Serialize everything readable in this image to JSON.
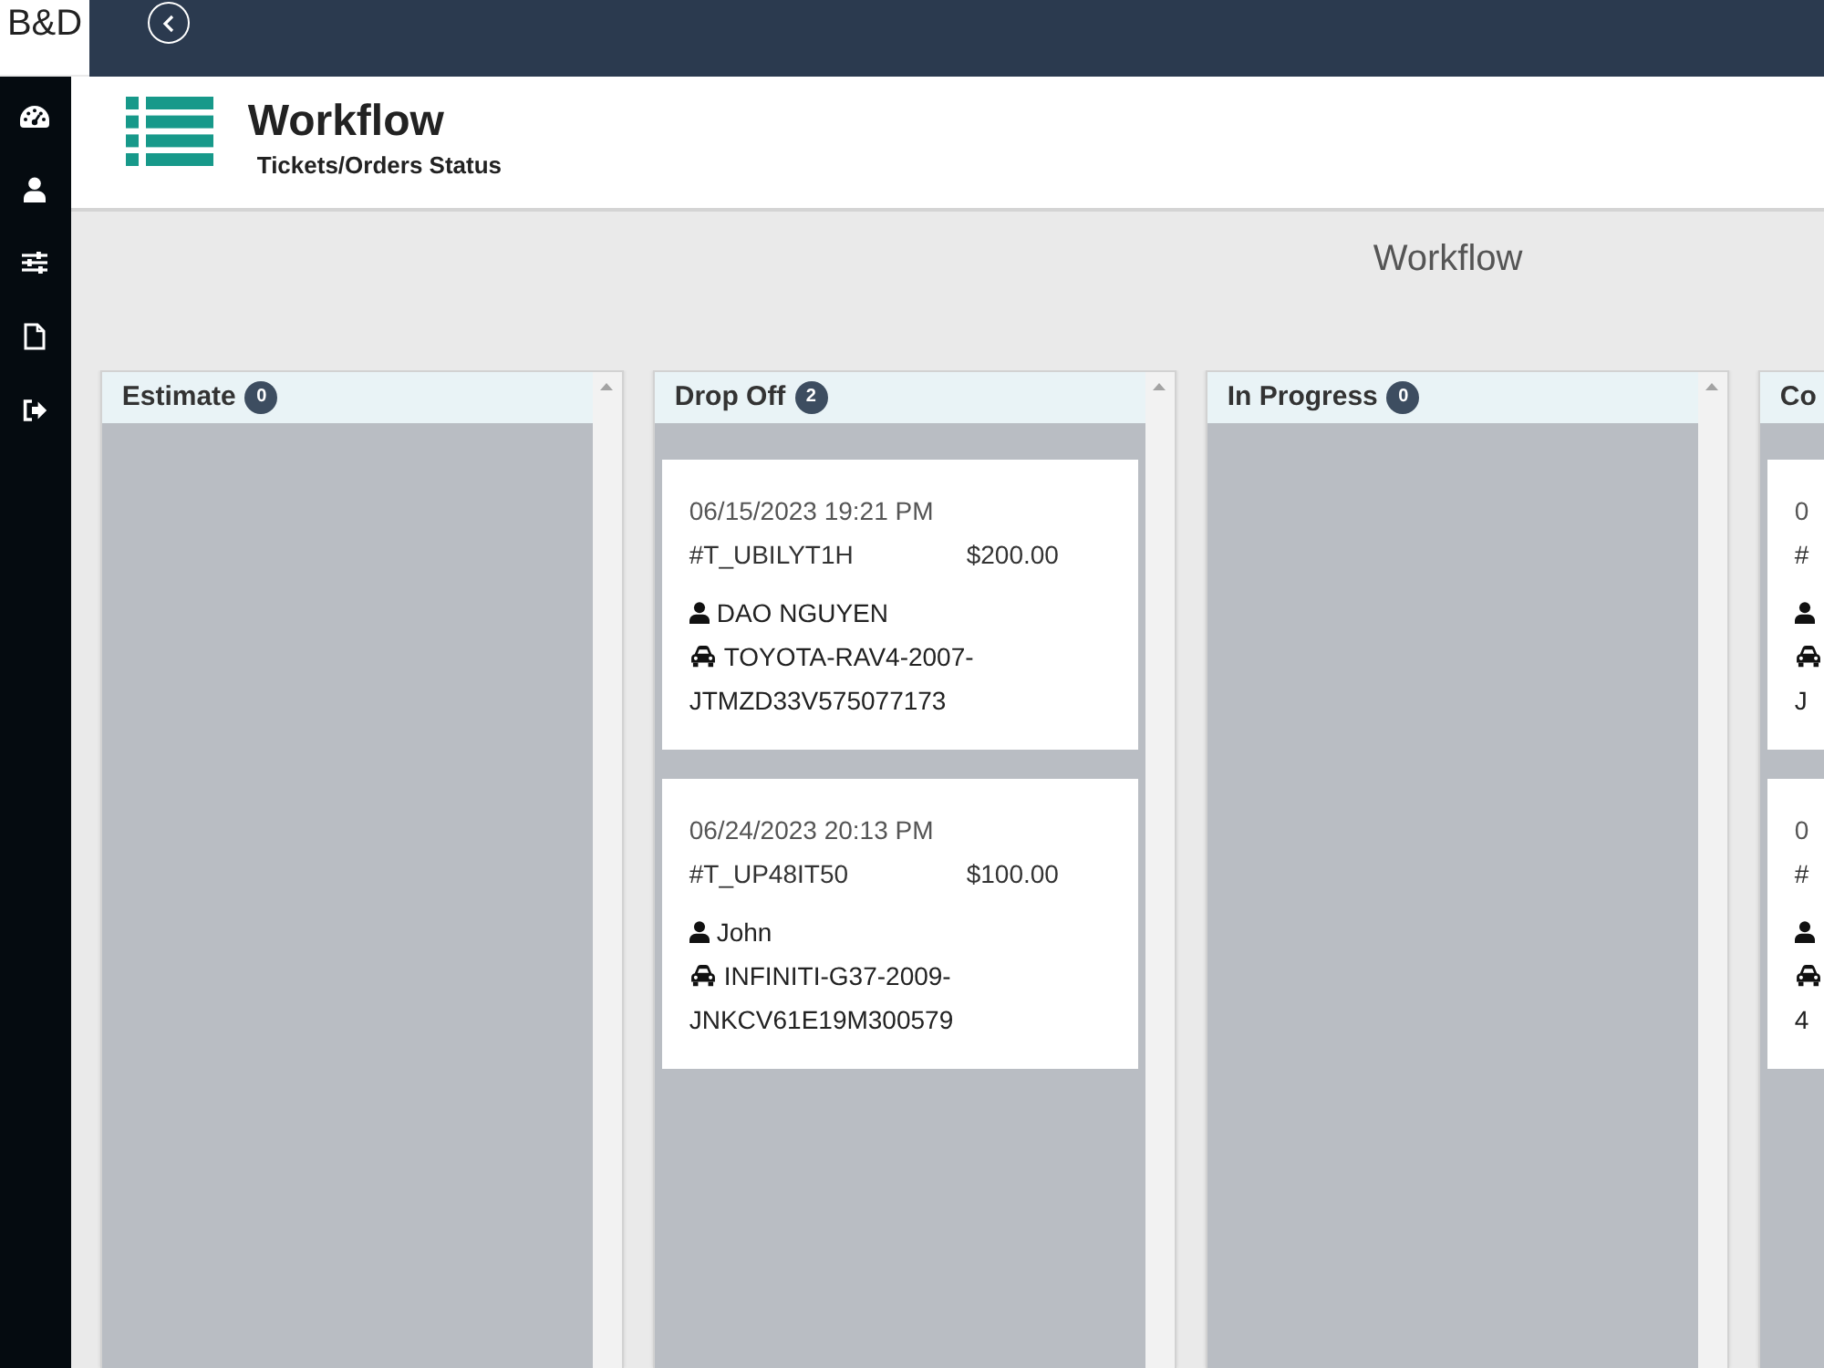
{
  "topbar": {
    "logo": "B&D"
  },
  "header": {
    "title": "Workflow",
    "subtitle": "Tickets/Orders Status"
  },
  "board": {
    "title": "Workflow",
    "columns": [
      {
        "name": "Estimate",
        "count": "0"
      },
      {
        "name": "Drop Off",
        "count": "2",
        "cards": [
          {
            "date": "06/15/2023 19:21 PM",
            "ticket": "#T_UBILYT1H",
            "amount": "$200.00",
            "customer": "DAO NGUYEN",
            "vehicle": "TOYOTA-RAV4-2007-",
            "vin": "JTMZD33V575077173"
          },
          {
            "date": "06/24/2023 20:13 PM",
            "ticket": "#T_UP48IT50",
            "amount": "$100.00",
            "customer": "John",
            "vehicle": "INFINITI-G37-2009-",
            "vin": "JNKCV61E19M300579"
          }
        ]
      },
      {
        "name": "In Progress",
        "count": "0"
      },
      {
        "name": "Co",
        "cards": [
          {
            "date": "0",
            "ticket": "#",
            "vin": "J"
          },
          {
            "date": "0",
            "ticket": "#",
            "vin": "4"
          }
        ]
      }
    ]
  }
}
